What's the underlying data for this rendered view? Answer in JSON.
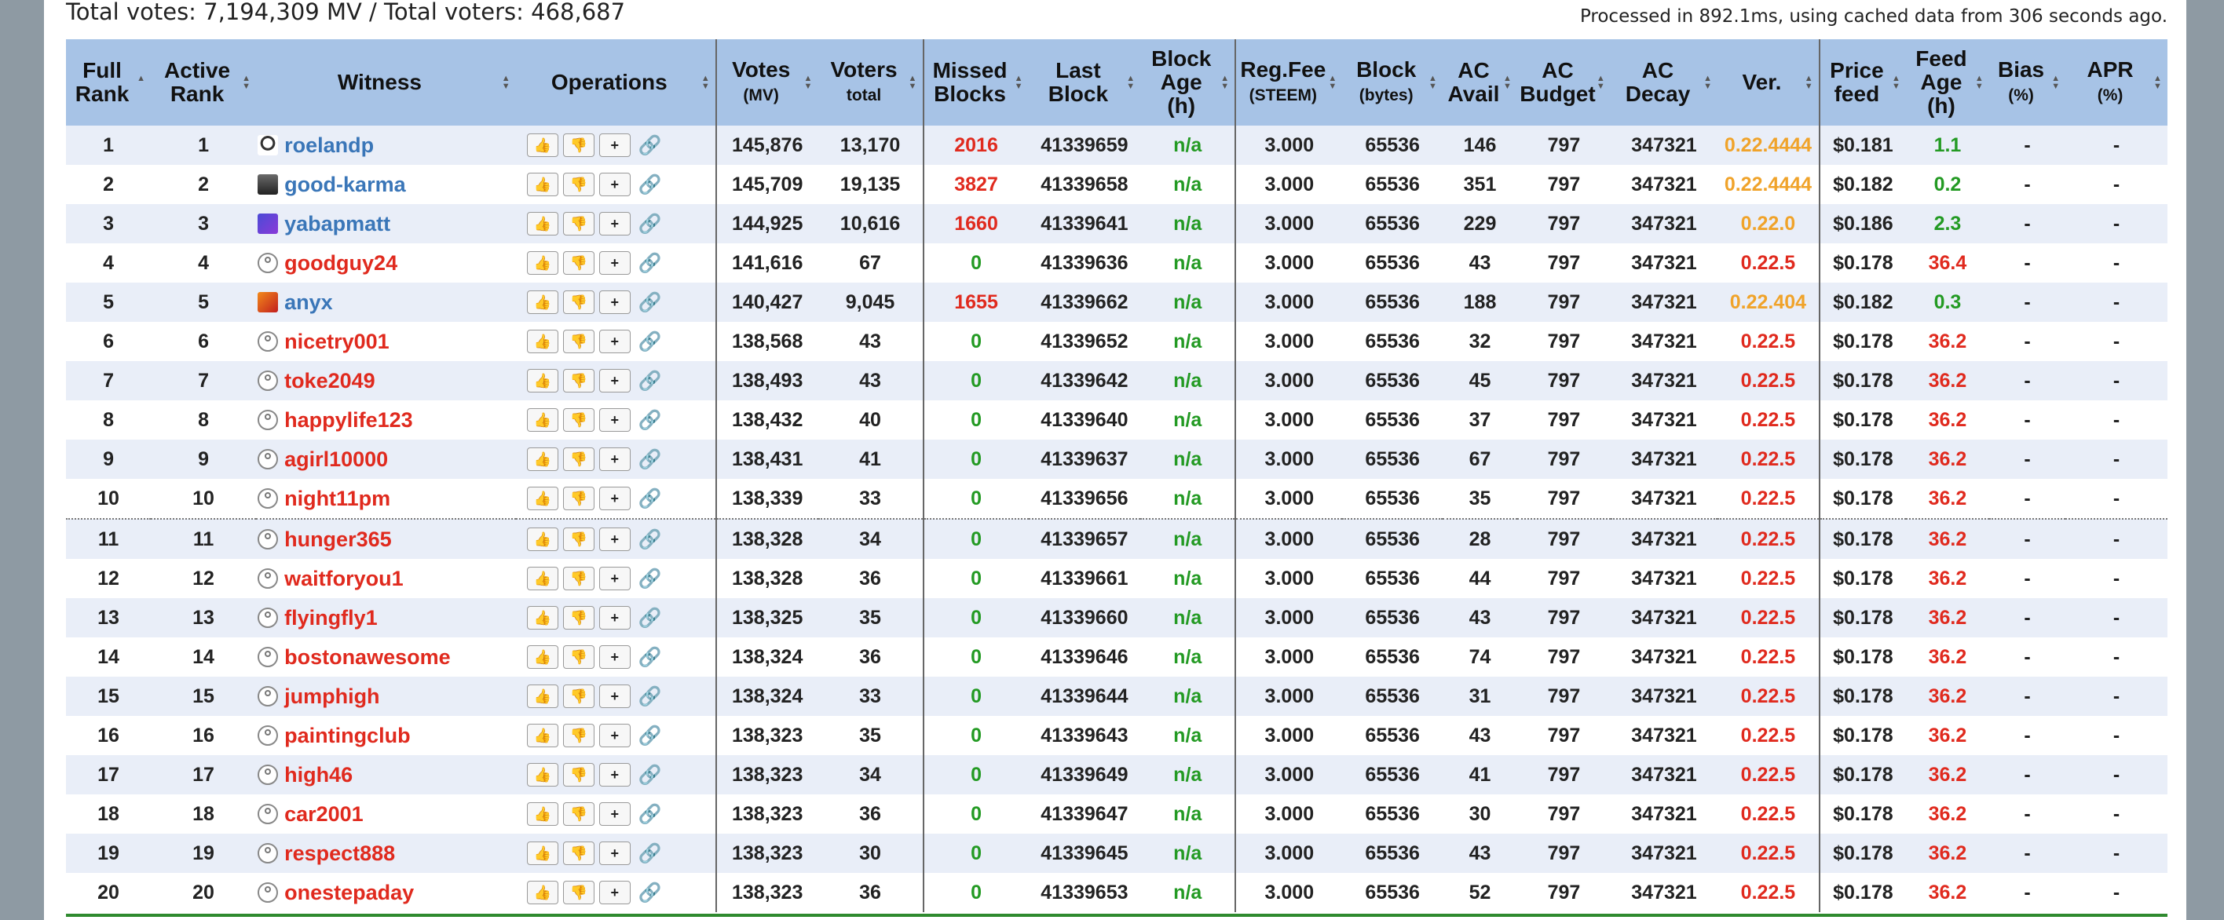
{
  "summary": "Total votes: 7,194,309 MV / Total voters: 468,687",
  "processed": "Processed in 892.1ms, using cached data from 306 seconds ago.",
  "headers": {
    "full_rank_1": "Full",
    "full_rank_2": "Rank",
    "active_rank_1": "Active",
    "active_rank_2": "Rank",
    "witness": "Witness",
    "operations": "Operations",
    "votes_1": "Votes",
    "votes_2": "(MV)",
    "voters_1": "Voters",
    "voters_2": "total",
    "missed_1": "Missed",
    "missed_2": "Blocks",
    "last_1": "Last",
    "last_2": "Block",
    "age_1": "Block",
    "age_2": "Age",
    "age_3": "(h)",
    "fee_1": "Reg.Fee",
    "fee_2": "(STEEM)",
    "block_1": "Block",
    "block_2": "(bytes)",
    "acavail_1": "AC",
    "acavail_2": "Avail",
    "acbudget_1": "AC",
    "acbudget_2": "Budget",
    "acdecay_1": "AC",
    "acdecay_2": "Decay",
    "ver": "Ver.",
    "price_1": "Price",
    "price_2": "feed",
    "feedage_1": "Feed",
    "feedage_2": "Age",
    "feedage_3": "(h)",
    "bias_1": "Bias",
    "bias_2": "(%)",
    "apr_1": "APR",
    "apr_2": "(%)"
  },
  "icons": {
    "up": "👍",
    "down": "👎",
    "user": "+",
    "link": "🔗"
  },
  "colors": {
    "active_name": "#3a76b8",
    "inactive_name": "#e02a1e",
    "header_bg": "#a7c3e6",
    "odd_row_bg": "#e9eef8"
  },
  "rows": [
    {
      "full": "1",
      "active": "1",
      "name": "roelandp",
      "status": "active",
      "avatar": "roelandp",
      "votes": "145,876",
      "voters": "13,170",
      "missed": "2016",
      "missed_c": "red",
      "last": "41339659",
      "age": "n/a",
      "fee": "3.000",
      "bytes": "65536",
      "acavail": "146",
      "acbudget": "797",
      "acdecay": "347321",
      "ver": "0.22.4444",
      "ver_c": "orange",
      "price": "$0.181",
      "feedage": "1.1",
      "feedage_c": "fdgreen",
      "bias": "-",
      "apr": "-"
    },
    {
      "full": "2",
      "active": "2",
      "name": "good-karma",
      "status": "active",
      "avatar": "good-karma",
      "votes": "145,709",
      "voters": "19,135",
      "missed": "3827",
      "missed_c": "red",
      "last": "41339658",
      "age": "n/a",
      "fee": "3.000",
      "bytes": "65536",
      "acavail": "351",
      "acbudget": "797",
      "acdecay": "347321",
      "ver": "0.22.4444",
      "ver_c": "orange",
      "price": "$0.182",
      "feedage": "0.2",
      "feedage_c": "fdgreen",
      "bias": "-",
      "apr": "-"
    },
    {
      "full": "3",
      "active": "3",
      "name": "yabapmatt",
      "status": "active",
      "avatar": "yabapmatt",
      "votes": "144,925",
      "voters": "10,616",
      "missed": "1660",
      "missed_c": "red",
      "last": "41339641",
      "age": "n/a",
      "fee": "3.000",
      "bytes": "65536",
      "acavail": "229",
      "acbudget": "797",
      "acdecay": "347321",
      "ver": "0.22.0",
      "ver_c": "orange",
      "price": "$0.186",
      "feedage": "2.3",
      "feedage_c": "fdgreen",
      "bias": "-",
      "apr": "-"
    },
    {
      "full": "4",
      "active": "4",
      "name": "goodguy24",
      "status": "inactive",
      "avatar": "default",
      "votes": "141,616",
      "voters": "67",
      "missed": "0",
      "missed_c": "green",
      "last": "41339636",
      "age": "n/a",
      "fee": "3.000",
      "bytes": "65536",
      "acavail": "43",
      "acbudget": "797",
      "acdecay": "347321",
      "ver": "0.22.5",
      "ver_c": "red",
      "price": "$0.178",
      "feedage": "36.4",
      "feedage_c": "red",
      "bias": "-",
      "apr": "-"
    },
    {
      "full": "5",
      "active": "5",
      "name": "anyx",
      "status": "active",
      "avatar": "anyx",
      "votes": "140,427",
      "voters": "9,045",
      "missed": "1655",
      "missed_c": "red",
      "last": "41339662",
      "age": "n/a",
      "fee": "3.000",
      "bytes": "65536",
      "acavail": "188",
      "acbudget": "797",
      "acdecay": "347321",
      "ver": "0.22.404",
      "ver_c": "orange",
      "price": "$0.182",
      "feedage": "0.3",
      "feedage_c": "fdgreen",
      "bias": "-",
      "apr": "-"
    },
    {
      "full": "6",
      "active": "6",
      "name": "nicetry001",
      "status": "inactive",
      "avatar": "default",
      "votes": "138,568",
      "voters": "43",
      "missed": "0",
      "missed_c": "green",
      "last": "41339652",
      "age": "n/a",
      "fee": "3.000",
      "bytes": "65536",
      "acavail": "32",
      "acbudget": "797",
      "acdecay": "347321",
      "ver": "0.22.5",
      "ver_c": "red",
      "price": "$0.178",
      "feedage": "36.2",
      "feedage_c": "red",
      "bias": "-",
      "apr": "-"
    },
    {
      "full": "7",
      "active": "7",
      "name": "toke2049",
      "status": "inactive",
      "avatar": "default",
      "votes": "138,493",
      "voters": "43",
      "missed": "0",
      "missed_c": "green",
      "last": "41339642",
      "age": "n/a",
      "fee": "3.000",
      "bytes": "65536",
      "acavail": "45",
      "acbudget": "797",
      "acdecay": "347321",
      "ver": "0.22.5",
      "ver_c": "red",
      "price": "$0.178",
      "feedage": "36.2",
      "feedage_c": "red",
      "bias": "-",
      "apr": "-"
    },
    {
      "full": "8",
      "active": "8",
      "name": "happylife123",
      "status": "inactive",
      "avatar": "default",
      "votes": "138,432",
      "voters": "40",
      "missed": "0",
      "missed_c": "green",
      "last": "41339640",
      "age": "n/a",
      "fee": "3.000",
      "bytes": "65536",
      "acavail": "37",
      "acbudget": "797",
      "acdecay": "347321",
      "ver": "0.22.5",
      "ver_c": "red",
      "price": "$0.178",
      "feedage": "36.2",
      "feedage_c": "red",
      "bias": "-",
      "apr": "-"
    },
    {
      "full": "9",
      "active": "9",
      "name": "agirl10000",
      "status": "inactive",
      "avatar": "default",
      "votes": "138,431",
      "voters": "41",
      "missed": "0",
      "missed_c": "green",
      "last": "41339637",
      "age": "n/a",
      "fee": "3.000",
      "bytes": "65536",
      "acavail": "67",
      "acbudget": "797",
      "acdecay": "347321",
      "ver": "0.22.5",
      "ver_c": "red",
      "price": "$0.178",
      "feedage": "36.2",
      "feedage_c": "red",
      "bias": "-",
      "apr": "-"
    },
    {
      "full": "10",
      "active": "10",
      "name": "night11pm",
      "status": "inactive",
      "avatar": "default",
      "votes": "138,339",
      "voters": "33",
      "missed": "0",
      "missed_c": "green",
      "last": "41339656",
      "age": "n/a",
      "fee": "3.000",
      "bytes": "65536",
      "acavail": "35",
      "acbudget": "797",
      "acdecay": "347321",
      "ver": "0.22.5",
      "ver_c": "red",
      "price": "$0.178",
      "feedage": "36.2",
      "feedage_c": "red",
      "bias": "-",
      "apr": "-"
    },
    {
      "full": "11",
      "active": "11",
      "name": "hunger365",
      "status": "inactive",
      "avatar": "default",
      "votes": "138,328",
      "voters": "34",
      "missed": "0",
      "missed_c": "green",
      "last": "41339657",
      "age": "n/a",
      "fee": "3.000",
      "bytes": "65536",
      "acavail": "28",
      "acbudget": "797",
      "acdecay": "347321",
      "ver": "0.22.5",
      "ver_c": "red",
      "price": "$0.178",
      "feedage": "36.2",
      "feedage_c": "red",
      "bias": "-",
      "apr": "-"
    },
    {
      "full": "12",
      "active": "12",
      "name": "waitforyou1",
      "status": "inactive",
      "avatar": "default",
      "votes": "138,328",
      "voters": "36",
      "missed": "0",
      "missed_c": "green",
      "last": "41339661",
      "age": "n/a",
      "fee": "3.000",
      "bytes": "65536",
      "acavail": "44",
      "acbudget": "797",
      "acdecay": "347321",
      "ver": "0.22.5",
      "ver_c": "red",
      "price": "$0.178",
      "feedage": "36.2",
      "feedage_c": "red",
      "bias": "-",
      "apr": "-"
    },
    {
      "full": "13",
      "active": "13",
      "name": "flyingfly1",
      "status": "inactive",
      "avatar": "default",
      "votes": "138,325",
      "voters": "35",
      "missed": "0",
      "missed_c": "green",
      "last": "41339660",
      "age": "n/a",
      "fee": "3.000",
      "bytes": "65536",
      "acavail": "43",
      "acbudget": "797",
      "acdecay": "347321",
      "ver": "0.22.5",
      "ver_c": "red",
      "price": "$0.178",
      "feedage": "36.2",
      "feedage_c": "red",
      "bias": "-",
      "apr": "-"
    },
    {
      "full": "14",
      "active": "14",
      "name": "bostonawesome",
      "status": "inactive",
      "avatar": "default",
      "votes": "138,324",
      "voters": "36",
      "missed": "0",
      "missed_c": "green",
      "last": "41339646",
      "age": "n/a",
      "fee": "3.000",
      "bytes": "65536",
      "acavail": "74",
      "acbudget": "797",
      "acdecay": "347321",
      "ver": "0.22.5",
      "ver_c": "red",
      "price": "$0.178",
      "feedage": "36.2",
      "feedage_c": "red",
      "bias": "-",
      "apr": "-"
    },
    {
      "full": "15",
      "active": "15",
      "name": "jumphigh",
      "status": "inactive",
      "avatar": "default",
      "votes": "138,324",
      "voters": "33",
      "missed": "0",
      "missed_c": "green",
      "last": "41339644",
      "age": "n/a",
      "fee": "3.000",
      "bytes": "65536",
      "acavail": "31",
      "acbudget": "797",
      "acdecay": "347321",
      "ver": "0.22.5",
      "ver_c": "red",
      "price": "$0.178",
      "feedage": "36.2",
      "feedage_c": "red",
      "bias": "-",
      "apr": "-"
    },
    {
      "full": "16",
      "active": "16",
      "name": "paintingclub",
      "status": "inactive",
      "avatar": "default",
      "votes": "138,323",
      "voters": "35",
      "missed": "0",
      "missed_c": "green",
      "last": "41339643",
      "age": "n/a",
      "fee": "3.000",
      "bytes": "65536",
      "acavail": "43",
      "acbudget": "797",
      "acdecay": "347321",
      "ver": "0.22.5",
      "ver_c": "red",
      "price": "$0.178",
      "feedage": "36.2",
      "feedage_c": "red",
      "bias": "-",
      "apr": "-"
    },
    {
      "full": "17",
      "active": "17",
      "name": "high46",
      "status": "inactive",
      "avatar": "default",
      "votes": "138,323",
      "voters": "34",
      "missed": "0",
      "missed_c": "green",
      "last": "41339649",
      "age": "n/a",
      "fee": "3.000",
      "bytes": "65536",
      "acavail": "41",
      "acbudget": "797",
      "acdecay": "347321",
      "ver": "0.22.5",
      "ver_c": "red",
      "price": "$0.178",
      "feedage": "36.2",
      "feedage_c": "red",
      "bias": "-",
      "apr": "-"
    },
    {
      "full": "18",
      "active": "18",
      "name": "car2001",
      "status": "inactive",
      "avatar": "default",
      "votes": "138,323",
      "voters": "36",
      "missed": "0",
      "missed_c": "green",
      "last": "41339647",
      "age": "n/a",
      "fee": "3.000",
      "bytes": "65536",
      "acavail": "30",
      "acbudget": "797",
      "acdecay": "347321",
      "ver": "0.22.5",
      "ver_c": "red",
      "price": "$0.178",
      "feedage": "36.2",
      "feedage_c": "red",
      "bias": "-",
      "apr": "-"
    },
    {
      "full": "19",
      "active": "19",
      "name": "respect888",
      "status": "inactive",
      "avatar": "default",
      "votes": "138,323",
      "voters": "30",
      "missed": "0",
      "missed_c": "green",
      "last": "41339645",
      "age": "n/a",
      "fee": "3.000",
      "bytes": "65536",
      "acavail": "43",
      "acbudget": "797",
      "acdecay": "347321",
      "ver": "0.22.5",
      "ver_c": "red",
      "price": "$0.178",
      "feedage": "36.2",
      "feedage_c": "red",
      "bias": "-",
      "apr": "-"
    },
    {
      "full": "20",
      "active": "20",
      "name": "onestepaday",
      "status": "inactive",
      "avatar": "default",
      "votes": "138,323",
      "voters": "36",
      "missed": "0",
      "missed_c": "green",
      "last": "41339653",
      "age": "n/a",
      "fee": "3.000",
      "bytes": "65536",
      "acavail": "52",
      "acbudget": "797",
      "acdecay": "347321",
      "ver": "0.22.5",
      "ver_c": "red",
      "price": "$0.178",
      "feedage": "36.2",
      "feedage_c": "red",
      "bias": "-",
      "apr": "-"
    }
  ]
}
